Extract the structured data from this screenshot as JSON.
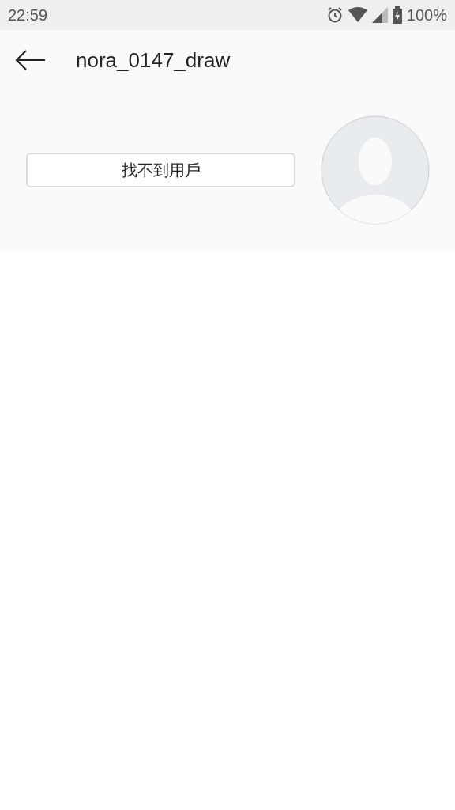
{
  "status_bar": {
    "time": "22:59",
    "battery": "100%"
  },
  "header": {
    "title": "nora_0147_draw"
  },
  "profile": {
    "button": "找不到用戶"
  }
}
